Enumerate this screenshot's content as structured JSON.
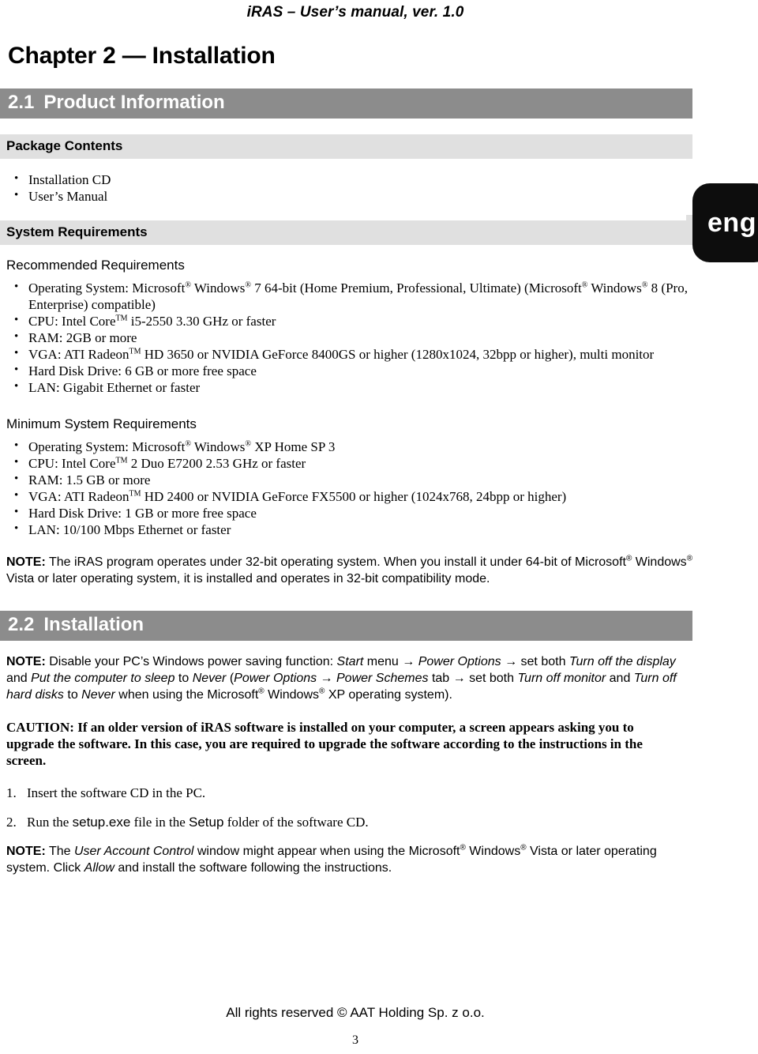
{
  "document": {
    "running_head": "iRAS – User’s manual, ver. 1.0",
    "chapter_title": "Chapter 2 — Installation",
    "language_tab": "eng",
    "footer_credit": "All rights reserved © AAT Holding Sp. z o.o.",
    "page_number": "3"
  },
  "colors": {
    "section_bar": "#8c8c8c",
    "subsection_bar": "#e0e0e0",
    "section_bar_text": "#ffffff",
    "tab_background": "#0d0d0d",
    "tab_text": "#ffffff",
    "body_text": "#000000",
    "page_background": "#ffffff"
  },
  "sections": {
    "product_information": {
      "number": "2.1",
      "title": "Product Information",
      "package_contents": {
        "heading": "Package Contents",
        "items": [
          "Installation CD",
          "User’s Manual"
        ]
      },
      "system_requirements": {
        "heading": "System Requirements",
        "recommended": {
          "heading": "Recommended Requirements",
          "items": {
            "os_prefix": "Operating System: Microsoft",
            "os_mid1": " Windows",
            "os_mid2": " 7 64-bit (Home Premium, Professional, Ultimate) (Microsoft",
            "os_mid3": " Windows",
            "os_suffix": " 8 (Pro, Enterprise) compatible)",
            "cpu_prefix": "CPU: Intel Core",
            "cpu_suffix": " i5-2550 3.30 GHz or faster",
            "ram": "RAM: 2GB or more",
            "vga_prefix": "VGA: ATI Radeon",
            "vga_suffix": " HD 3650 or NVIDIA GeForce 8400GS or higher (1280x1024, 32bpp or higher), multi monitor",
            "hdd": "Hard Disk Drive: 6 GB or more free space",
            "lan": "LAN: Gigabit Ethernet or faster"
          }
        },
        "minimum": {
          "heading": "Minimum System Requirements",
          "items": {
            "os_prefix": "Operating System: Microsoft",
            "os_mid1": " Windows",
            "os_suffix": " XP Home SP 3",
            "cpu_prefix": "CPU: Intel Core",
            "cpu_suffix": " 2 Duo E7200 2.53 GHz or faster",
            "ram": "RAM: 1.5 GB or more",
            "vga_prefix": "VGA: ATI Radeon",
            "vga_suffix": " HD 2400 or NVIDIA GeForce FX5500 or higher (1024x768, 24bpp or higher)",
            "hdd": "Hard Disk Drive: 1 GB or more free space",
            "lan": "LAN: 10/100 Mbps Ethernet or faster"
          }
        },
        "note": {
          "label": "NOTE:",
          "text_1": " The iRAS program operates under 32-bit operating system.  When you install it under 64-bit of Microsoft",
          "text_2": " Windows",
          "text_3": " Vista or later operating system, it is installed and operates in 32-bit compatibility mode."
        }
      }
    },
    "installation": {
      "number": "2.2",
      "title": "Installation",
      "note_power": {
        "label": "NOTE:",
        "t1": " Disable your PC’s Windows power saving function: ",
        "i1": "Start",
        "t2": " menu → ",
        "i2": "Power Options",
        "t3": " → set both ",
        "i3": "Turn off the display",
        "t4": " and ",
        "i4": "Put the computer to sleep",
        "t5": " to ",
        "i5": "Never",
        "t6": " (",
        "i6": "Power Options",
        "t7": " → ",
        "i7": "Power Schemes",
        "t8": " tab → set both ",
        "i8": "Turn off monitor",
        "t9": " and ",
        "i9": "Turn off hard disks",
        "t10": " to ",
        "i10": "Never",
        "t11": " when using the Microsoft",
        "t12": " Windows",
        "t13": " XP operating system)."
      },
      "caution": {
        "label": "CAUTION:",
        "text": " If an older version of iRAS software is installed on your computer, a screen appears asking you to upgrade the software.  In this case, you are required to upgrade the software according to the instructions in the screen."
      },
      "steps": [
        {
          "number": "1.",
          "text": "Insert the software CD in the PC."
        },
        {
          "number": "2.",
          "prefix": "Run the ",
          "bold_1": "setup.exe",
          "mid": " file in the ",
          "bold_2": "Setup",
          "suffix": " folder of the software CD."
        }
      ],
      "note_uac": {
        "label": "NOTE:",
        "t1": " The ",
        "i1": "User Account Control",
        "t2": " window might appear when using the Microsoft",
        "t3": " Windows",
        "t4": " Vista or later operating system. Click ",
        "i2": "Allow",
        "t5": " and install the software following the instructions."
      }
    }
  },
  "symbols": {
    "registered": "®",
    "trademark": "TM",
    "bullet": "•"
  }
}
